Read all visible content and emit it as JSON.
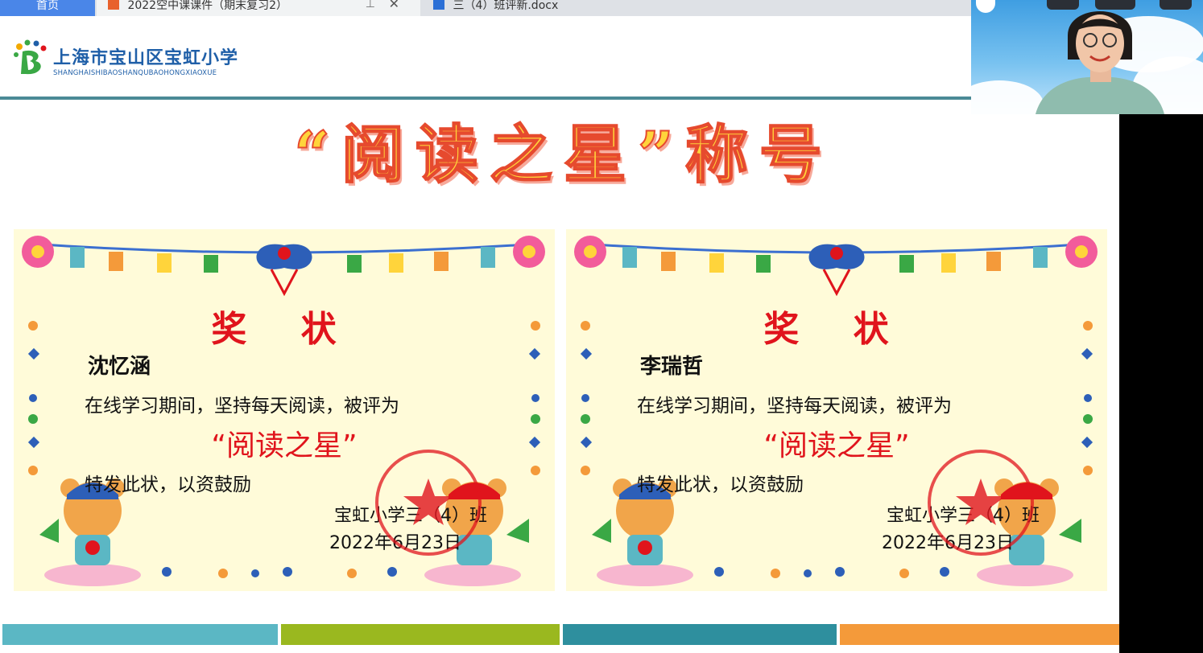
{
  "browser": {
    "tabs": [
      {
        "label": "首页",
        "icon": "home-tab"
      },
      {
        "label": "2022空中课课件（期末复习2）",
        "icon": "powerpoint-icon"
      },
      {
        "label": "三（4）班评新.docx",
        "icon": "word-doc-icon"
      }
    ]
  },
  "slide": {
    "school_name": "上海市宝山区宝虹小学",
    "school_pinyin": "SHANGHAISHIBAOSHANQUBAOHONGXIAOXUE",
    "title": "“阅读之星”称号",
    "certificates": [
      {
        "award_title": "奖 状",
        "recipient": "沈忆涵",
        "body_line": "在线学习期间，坚持每天阅读，被评为",
        "honor": "“阅读之星”",
        "closing": "特发此状，以资鼓励",
        "issuer": "宝虹小学三（4）班",
        "date": "2022年6月23日",
        "seal_text": "小学三（4）班"
      },
      {
        "award_title": "奖 状",
        "recipient": "李瑞哲",
        "body_line": "在线学习期间，坚持每天阅读，被评为",
        "honor": "“阅读之星”",
        "closing": "特发此状，以资鼓励",
        "issuer": "宝虹小学三（4）班",
        "date": "2022年6月23日",
        "seal_text": "小学三（4）班"
      }
    ],
    "footer_colors": [
      "#5bb7c4",
      "#9ab81f",
      "#2e8f9e",
      "#f49a3a"
    ]
  },
  "colors": {
    "award_red": "#e0141c",
    "school_blue": "#1f5fa8",
    "title_yellow": "#ffd43b",
    "certificate_bg": "#fffbd9"
  }
}
